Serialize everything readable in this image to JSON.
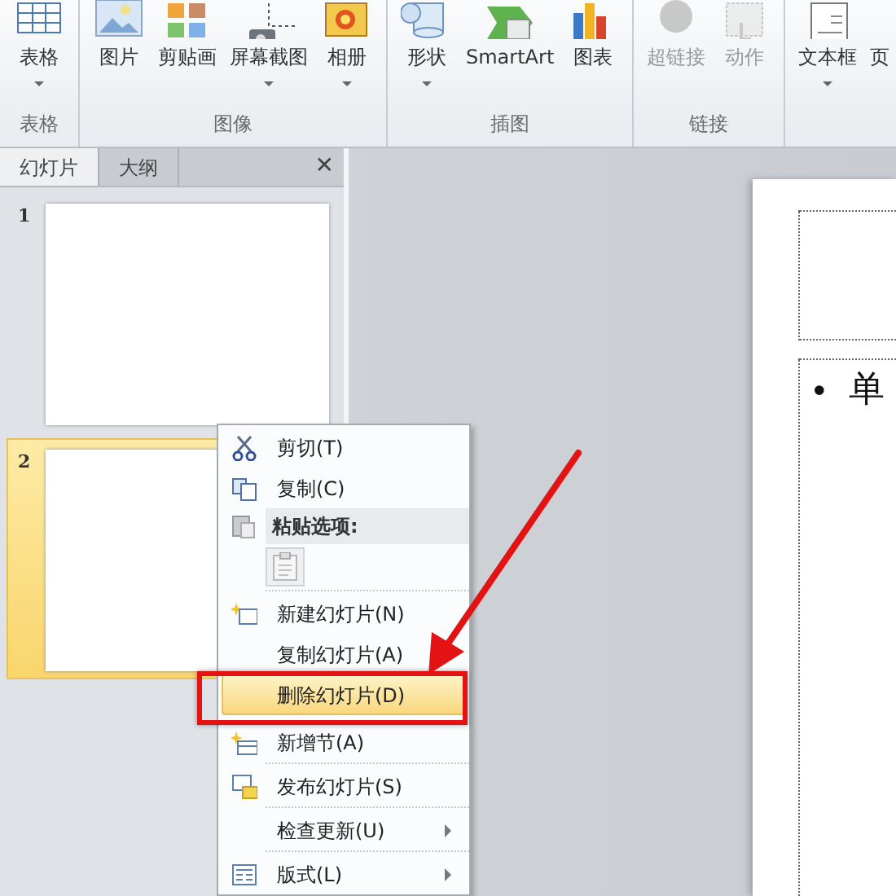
{
  "ribbon": {
    "groups": [
      {
        "label": "表格",
        "buttons": [
          {
            "label": "表格",
            "dropdown": true,
            "disabled": false
          }
        ]
      },
      {
        "label": "图像",
        "buttons": [
          {
            "label": "图片",
            "dropdown": false,
            "disabled": false
          },
          {
            "label": "剪贴画",
            "dropdown": false,
            "disabled": false
          },
          {
            "label": "屏幕截图",
            "dropdown": true,
            "disabled": false
          },
          {
            "label": "相册",
            "dropdown": true,
            "disabled": false
          }
        ]
      },
      {
        "label": "插图",
        "buttons": [
          {
            "label": "形状",
            "dropdown": true,
            "disabled": false
          },
          {
            "label": "SmartArt",
            "dropdown": false,
            "disabled": false
          },
          {
            "label": "图表",
            "dropdown": false,
            "disabled": false
          }
        ]
      },
      {
        "label": "链接",
        "buttons": [
          {
            "label": "超链接",
            "dropdown": false,
            "disabled": true
          },
          {
            "label": "动作",
            "dropdown": false,
            "disabled": true
          }
        ]
      },
      {
        "buttons": [
          {
            "label": "文本框",
            "dropdown": true,
            "disabled": false
          },
          {
            "label": "页",
            "dropdown": false,
            "disabled": false
          }
        ]
      }
    ]
  },
  "pane": {
    "tabs": [
      {
        "label": "幻灯片",
        "selected": true
      },
      {
        "label": "大纲",
        "selected": false
      }
    ],
    "close": "✕",
    "slides": [
      {
        "number": "1",
        "selected": false
      },
      {
        "number": "2",
        "selected": true
      }
    ]
  },
  "editor": {
    "bullet": "•",
    "body_text": "单"
  },
  "context_menu": {
    "items": [
      {
        "kind": "item",
        "label": "剪切(T)",
        "highlighted": false
      },
      {
        "kind": "item",
        "label": "复制(C)",
        "highlighted": false
      },
      {
        "kind": "header",
        "label": "粘贴选项:"
      },
      {
        "kind": "paste-options"
      },
      {
        "kind": "separator"
      },
      {
        "kind": "item",
        "label": "新建幻灯片(N)",
        "highlighted": false
      },
      {
        "kind": "item",
        "label": "复制幻灯片(A)",
        "highlighted": false
      },
      {
        "kind": "item",
        "label": "删除幻灯片(D)",
        "highlighted": true
      },
      {
        "kind": "item",
        "label": "新增节(A)",
        "highlighted": false
      },
      {
        "kind": "separator"
      },
      {
        "kind": "item",
        "label": "发布幻灯片(S)",
        "highlighted": false
      },
      {
        "kind": "separator"
      },
      {
        "kind": "submenu",
        "label": "检查更新(U)",
        "highlighted": false
      },
      {
        "kind": "separator"
      },
      {
        "kind": "submenu",
        "label": "版式(L)",
        "highlighted": false
      }
    ]
  }
}
